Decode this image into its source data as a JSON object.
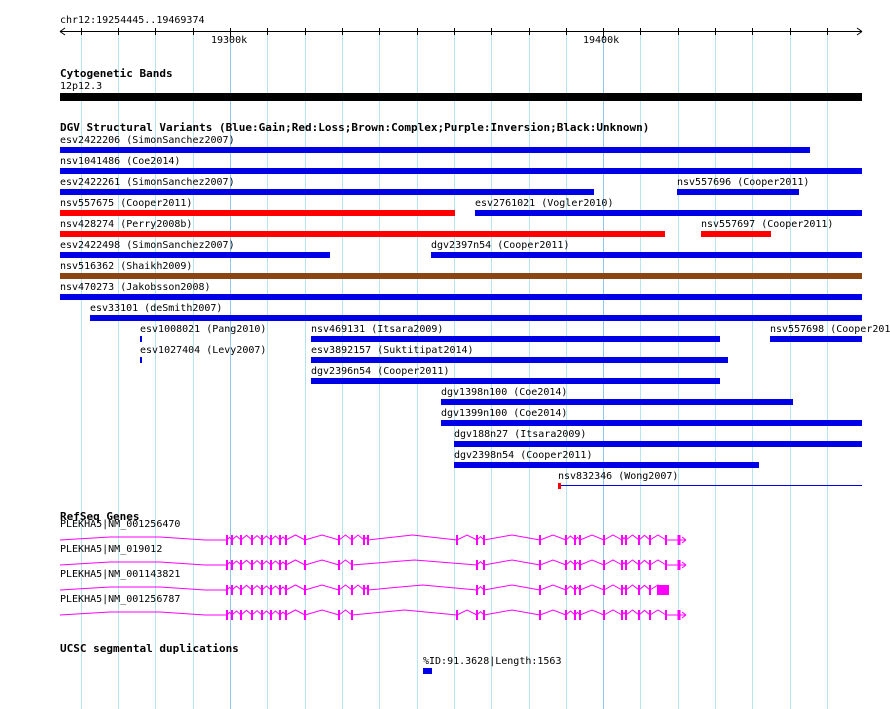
{
  "ruler": {
    "location": "chr12:19254445..19469374",
    "ticks": [
      "19300k",
      "19400k"
    ]
  },
  "cyto": {
    "title": "Cytogenetic Bands",
    "band": "12p12.3"
  },
  "dgv": {
    "title": "DGV Structural Variants (Blue:Gain;Red:Loss;Brown:Complex;Purple:Inversion;Black:Unknown)",
    "features": [
      {
        "label": "esv2422206 (SimonSanchez2007)",
        "type": "gain"
      },
      {
        "label": "nsv1041486 (Coe2014)",
        "type": "gain"
      },
      {
        "label": "esv2422261 (SimonSanchez2007)",
        "type": "gain"
      },
      {
        "label": "nsv557696 (Cooper2011)",
        "type": "gain"
      },
      {
        "label": "nsv557675 (Cooper2011)",
        "type": "loss"
      },
      {
        "label": "esv2761021 (Vogler2010)",
        "type": "gain"
      },
      {
        "label": "nsv428274 (Perry2008b)",
        "type": "loss"
      },
      {
        "label": "nsv557697 (Cooper2011)",
        "type": "loss"
      },
      {
        "label": "esv2422498 (SimonSanchez2007)",
        "type": "gain"
      },
      {
        "label": "dgv2397n54 (Cooper2011)",
        "type": "gain"
      },
      {
        "label": "nsv516362 (Shaikh2009)",
        "type": "complex"
      },
      {
        "label": "nsv470273 (Jakobsson2008)",
        "type": "gain"
      },
      {
        "label": "esv33101 (deSmith2007)",
        "type": "gain"
      },
      {
        "label": "esv1008021 (Pang2010)",
        "type": "gain"
      },
      {
        "label": "nsv469131 (Itsara2009)",
        "type": "gain"
      },
      {
        "label": "nsv557698 (Cooper201",
        "type": "gain"
      },
      {
        "label": "esv1027404 (Levy2007)",
        "type": "gain"
      },
      {
        "label": "esv3892157 (Suktitipat2014)",
        "type": "gain"
      },
      {
        "label": "dgv2396n54 (Cooper2011)",
        "type": "gain"
      },
      {
        "label": "dgv1398n100 (Coe2014)",
        "type": "gain"
      },
      {
        "label": "dgv1399n100 (Coe2014)",
        "type": "gain"
      },
      {
        "label": "dgv188n27 (Itsara2009)",
        "type": "gain"
      },
      {
        "label": "dgv2398n54 (Cooper2011)",
        "type": "gain"
      },
      {
        "label": "nsv832346 (Wong2007)",
        "type": "loss"
      }
    ]
  },
  "colors": {
    "gain": "#0000e6",
    "loss": "#ff0000",
    "complex": "#8b4513",
    "gene": "#ff00ff",
    "grid": "#b6e4ee"
  },
  "refseq": {
    "title": "RefSeq Genes",
    "transcripts": [
      "PLEKHA5|NM_001256470",
      "PLEKHA5|NM_019012",
      "PLEKHA5|NM_001143821",
      "PLEKHA5|NM_001256787"
    ]
  },
  "segdup": {
    "title": "UCSC segmental duplications",
    "feature": "%ID:91.3628|Length:1563"
  }
}
